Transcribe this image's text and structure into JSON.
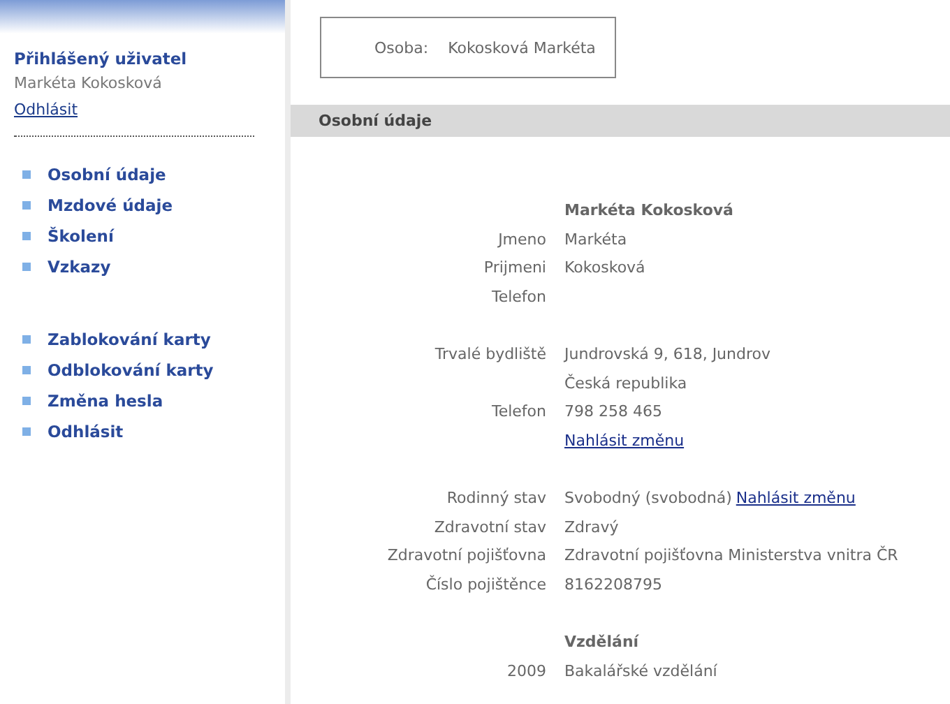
{
  "user_panel": {
    "title": "Přihlášený uživatel",
    "name": "Markéta Kokosková",
    "logout_link": "Odhlásit"
  },
  "menu_groups": [
    {
      "items": [
        "Osobní údaje",
        "Mzdové údaje",
        "Školení",
        "Vzkazy"
      ]
    },
    {
      "items": [
        "Zablokování karty",
        "Odblokování karty",
        "Změna hesla",
        "Odhlásit"
      ]
    }
  ],
  "person": {
    "label": "Osoba:",
    "value": "Kokosková Markéta"
  },
  "section_title": "Osobní údaje",
  "groups": [
    {
      "heading": "Markéta Kokosková",
      "rows": [
        {
          "label": "Jmeno",
          "value": "Markéta"
        },
        {
          "label": "Prijmeni",
          "value": "Kokosková"
        },
        {
          "label": "Telefon"
        }
      ]
    },
    {
      "rows": [
        {
          "label": "Trvalé bydliště",
          "value": "Jundrovská 9, 618, Jundrov"
        },
        {
          "value": "Česká republika"
        },
        {
          "label": "Telefon",
          "value": "798 258 465"
        },
        {
          "link": "Nahlásit změnu"
        }
      ]
    },
    {
      "rows": [
        {
          "label": "Rodinný stav",
          "value": "Svobodný (svobodná)",
          "link": "Nahlásit změnu"
        },
        {
          "label": "Zdravotní stav",
          "value": "Zdravý"
        },
        {
          "label": "Zdravotní pojišťovna",
          "value": "Zdravotní pojišťovna Ministerstva vnitra ČR"
        },
        {
          "label": "Číslo pojištěnce",
          "value": "8162208795"
        }
      ]
    },
    {
      "heading": "Vzdělání",
      "rows": [
        {
          "label": "2009",
          "value": "Bakalářské vzdělání"
        }
      ]
    }
  ]
}
